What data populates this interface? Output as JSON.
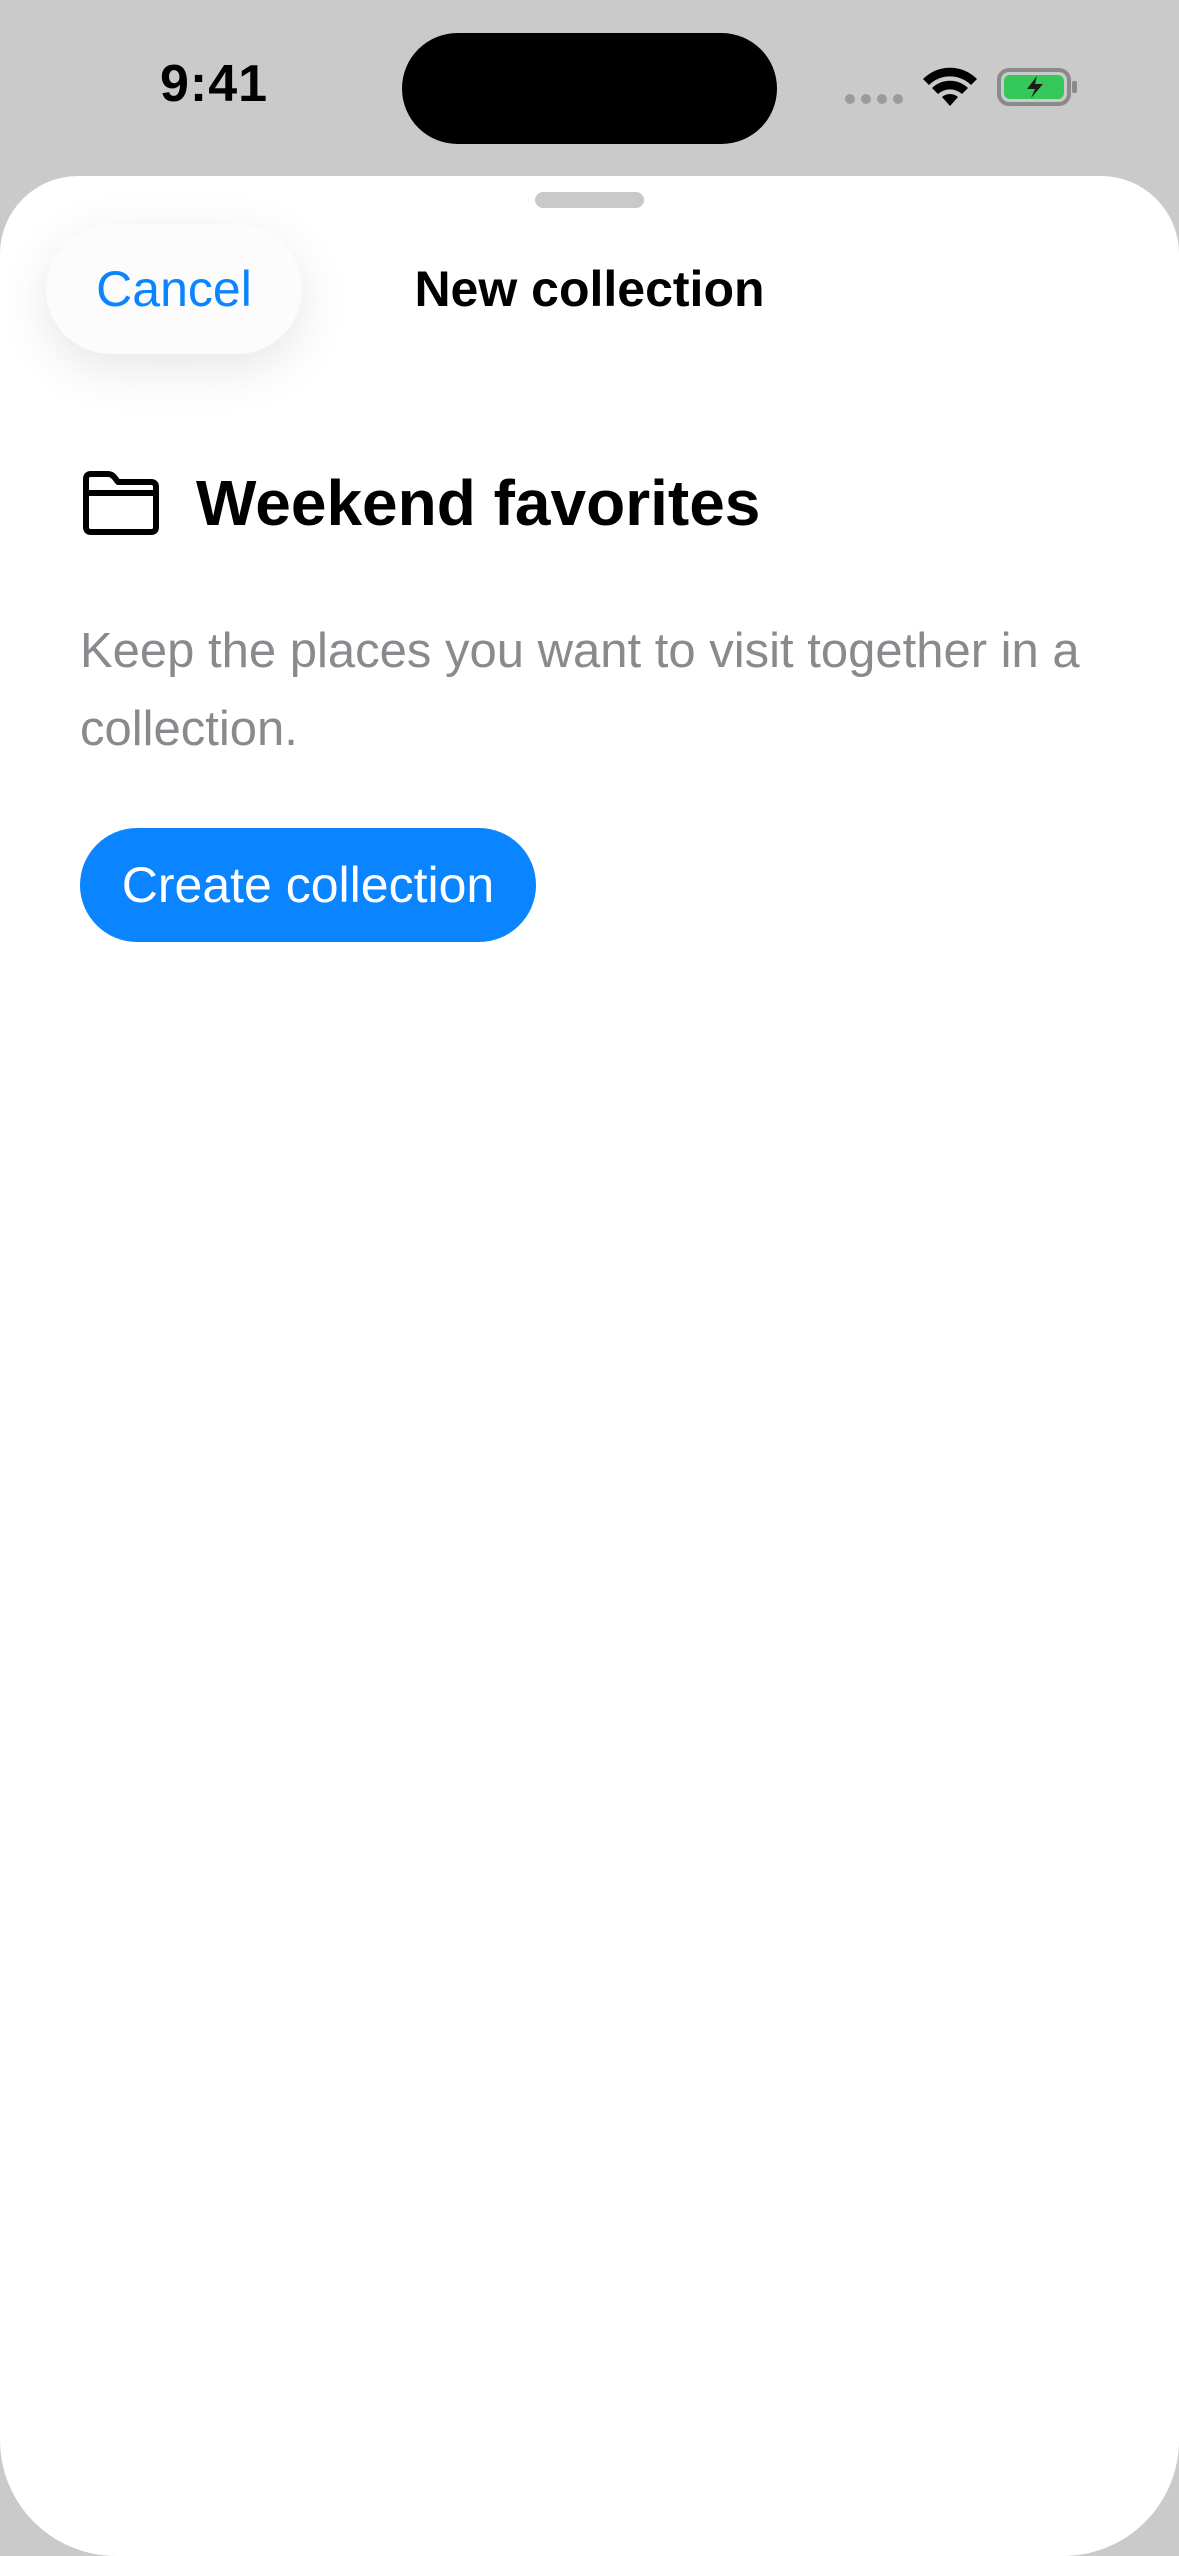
{
  "status_bar": {
    "time": "9:41",
    "battery_color": "#34c759"
  },
  "sheet": {
    "cancel_label": "Cancel",
    "title": "New collection",
    "collection_name": "Weekend favorites",
    "description": "Keep the places you want to visit together in a collection.",
    "create_label": "Create collection",
    "accent_color": "#0a84ff"
  }
}
